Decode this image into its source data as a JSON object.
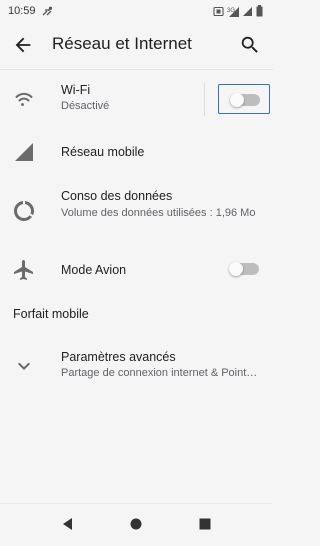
{
  "status_bar": {
    "time": "10:59",
    "icons": [
      "notification-icon",
      "vibrate-icon",
      "data-4g-icon",
      "signal-icon",
      "battery-icon"
    ]
  },
  "toolbar": {
    "title": "Réseau et Internet",
    "back_icon": "arrow-back-icon",
    "search_icon": "search-icon"
  },
  "rows": {
    "wifi": {
      "title": "Wi-Fi",
      "subtitle": "Désactivé",
      "icon": "wifi-icon",
      "toggle_on": false
    },
    "mobile": {
      "title": "Réseau mobile",
      "icon": "signal-icon"
    },
    "data": {
      "title": "Conso des données",
      "subtitle": "Volume des données utilisées : 1,96 Mo",
      "icon": "data-usage-icon"
    },
    "airplane": {
      "title": "Mode Avion",
      "icon": "airplane-icon",
      "toggle_on": false
    },
    "advanced": {
      "title": "Paramètres avancés",
      "subtitle": "Partage de connexion internet & Point…",
      "icon": "chevron-down-icon"
    }
  },
  "section": {
    "forfait": "Forfait mobile"
  },
  "nav": {
    "back": "nav-back-icon",
    "home": "nav-home-icon",
    "recents": "nav-recents-icon"
  },
  "colors": {
    "background": "#f5f5f5",
    "focus_outline": "#3d6fb6",
    "toggle_off": "#bdbdbd"
  }
}
